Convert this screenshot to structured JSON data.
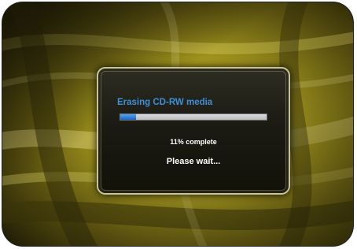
{
  "dialog": {
    "title": "Erasing CD-RW media",
    "progress_text": "11% complete",
    "status": "Please wait..."
  },
  "progress": {
    "fraction": 0.11
  },
  "colors": {
    "title": "#3d8fd8",
    "progress_fill": "#2a7fd6",
    "background_gold": "#a89a1e"
  }
}
